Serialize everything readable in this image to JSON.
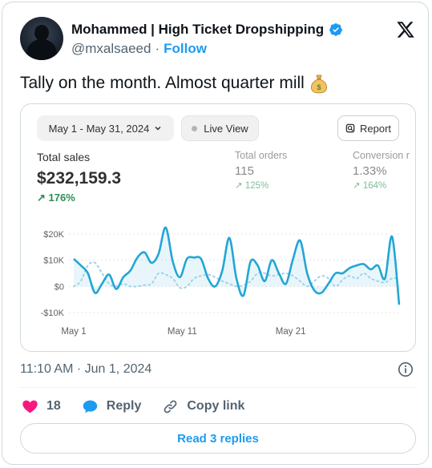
{
  "author": {
    "name": "Mohammed | High Ticket Dropshipping",
    "handle": "@mxalsaeed",
    "separator": "·",
    "follow_label": "Follow"
  },
  "tweet": {
    "text": "Tally on the month. Almost quarter mill",
    "emoji": "money-bag"
  },
  "dashboard": {
    "date_range": "May 1 - May 31, 2024",
    "live_view_label": "Live View",
    "report_label": "Report",
    "metrics": [
      {
        "label": "Total sales",
        "value": "$232,159.3",
        "change": "↗ 176%"
      },
      {
        "label": "Total orders",
        "value": "115",
        "change": "↗ 125%"
      },
      {
        "label": "Conversion r",
        "value": "1.33%",
        "change": "↗ 164%"
      }
    ]
  },
  "chart_data": {
    "type": "line",
    "x_labels": [
      "May 1",
      "May 11",
      "May 21"
    ],
    "y_ticks": [
      "$20K",
      "$10K",
      "$0",
      "-$10K"
    ],
    "ylim": [
      -10000,
      20000
    ],
    "grid": true,
    "series": [
      {
        "name": "",
        "style": "solid",
        "color": "#22a6d6",
        "values": [
          10500,
          8000,
          5000,
          -2500,
          1000,
          4500,
          -1000,
          3500,
          6000,
          11000,
          13000,
          9000,
          12500,
          22500,
          9500,
          3500,
          10500,
          11000,
          10500,
          3000,
          0,
          6000,
          18500,
          3000,
          -3500,
          9500,
          8000,
          2000,
          10000,
          5000,
          1000,
          10500,
          17500,
          5000,
          -1500,
          -2500,
          1000,
          5000,
          5000,
          7000,
          8000,
          8500,
          6500,
          8000,
          3000,
          19000,
          -7000
        ]
      },
      {
        "name": "",
        "style": "dotted",
        "color": "#9fd3e8",
        "values": [
          0,
          2000,
          8000,
          9000,
          5000,
          1000,
          0,
          1000,
          0,
          0,
          500,
          1000,
          5000,
          4500,
          3000,
          -500,
          0,
          3000,
          4000,
          4500,
          3500,
          2000,
          1000,
          0,
          500,
          2000,
          5000,
          5000,
          4000,
          4500,
          5000,
          4000,
          2000,
          0,
          2000,
          4000,
          3000,
          0,
          2500,
          4000,
          3000,
          5000,
          3000,
          2000,
          1500,
          3000,
          3000
        ]
      }
    ]
  },
  "meta": {
    "time": "11:10 AM",
    "separator": "·",
    "date": "Jun 1, 2024"
  },
  "actions": {
    "like_count": "18",
    "reply_label": "Reply",
    "copy_label": "Copy link",
    "read_replies": "Read 3 replies"
  },
  "colors": {
    "accent": "#1d9bf0",
    "like": "#f91880",
    "positive": "#2e8b57"
  }
}
